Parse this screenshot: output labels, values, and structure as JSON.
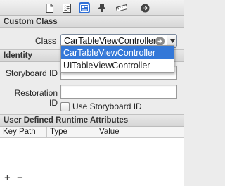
{
  "toolbar": {
    "tabs": [
      {
        "icon": "file-inspector-icon"
      },
      {
        "icon": "quick-help-icon"
      },
      {
        "icon": "identity-inspector-icon",
        "selected": true
      },
      {
        "icon": "attributes-inspector-icon"
      },
      {
        "icon": "size-inspector-icon"
      },
      {
        "icon": "connections-inspector-icon"
      }
    ]
  },
  "custom_class": {
    "title": "Custom Class",
    "class_label": "Class",
    "class_value": "CarTableViewController",
    "dropdown_options": [
      "CarTableViewController",
      "UITableViewController"
    ],
    "highlighted_option": "CarTableViewController"
  },
  "identity": {
    "title": "Identity",
    "storyboard_id_label": "Storyboard ID",
    "storyboard_id_value": "",
    "restoration_id_label": "Restoration ID",
    "restoration_id_value": "",
    "use_storyboard_id_label": "Use Storyboard ID",
    "use_storyboard_id_checked": false
  },
  "runtime_attributes": {
    "title": "User Defined Runtime Attributes",
    "columns": [
      "Key Path",
      "Type",
      "Value"
    ],
    "add_label": "+",
    "remove_label": "−"
  },
  "colors": {
    "selection": "#3478d8",
    "selected_tab": "#2f6fd6"
  }
}
